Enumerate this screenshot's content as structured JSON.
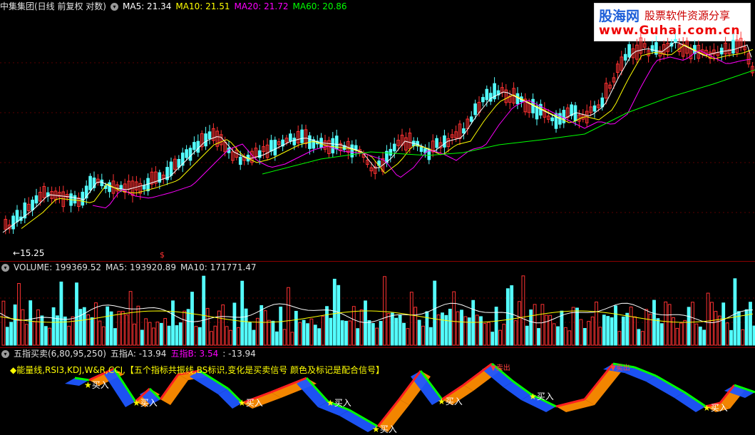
{
  "main_header": {
    "stock_name": "中集集团(日线 前复权 对数)",
    "ma5": "MA5: 21.34",
    "ma10": "MA10: 21.51",
    "ma20": "MA20: 21.72",
    "ma60": "MA60: 20.86"
  },
  "low_marker": "15.25",
  "volume_header": {
    "volume": "VOLUME: 199369.52",
    "ma5": "MA5: 193920.89",
    "ma10": "MA10: 171771.47"
  },
  "indicator_header": {
    "name": "五指买卖(6,80,95,250)",
    "a": "五指A: -13.94",
    "b": "五指B: 3.54",
    "c": ": -13.94"
  },
  "indicator_note": "◆能量线,RSI3,KDJ,W&R,CCI,【五个指标共振线,BS标识,变化是买卖信号 颜色及标记是配合信号】",
  "logo": {
    "title": "股海网",
    "subtitle": "股票软件资源分享",
    "url": "www.Guhai.com.cn"
  },
  "signals": {
    "buy": "买入",
    "sell": "卖出"
  },
  "colors": {
    "up": "#ff3232",
    "down": "#54ffff",
    "ma5": "#ffffff",
    "ma10": "#ffff00",
    "ma20": "#ff00ff",
    "ma60": "#00ff00"
  }
}
